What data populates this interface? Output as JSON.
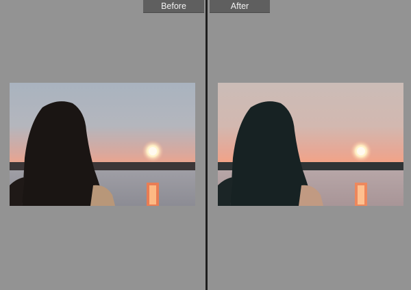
{
  "labels": {
    "before": "Before",
    "after": "After"
  },
  "colors": {
    "background": "#939393",
    "divider": "#1f1f1f",
    "tab_bg": "#5f5f5f",
    "tab_text": "#f2f2f2"
  },
  "images": {
    "before": {
      "description_icon": "sunset-portrait-photo"
    },
    "after": {
      "description_icon": "sunset-portrait-photo-edited"
    }
  }
}
